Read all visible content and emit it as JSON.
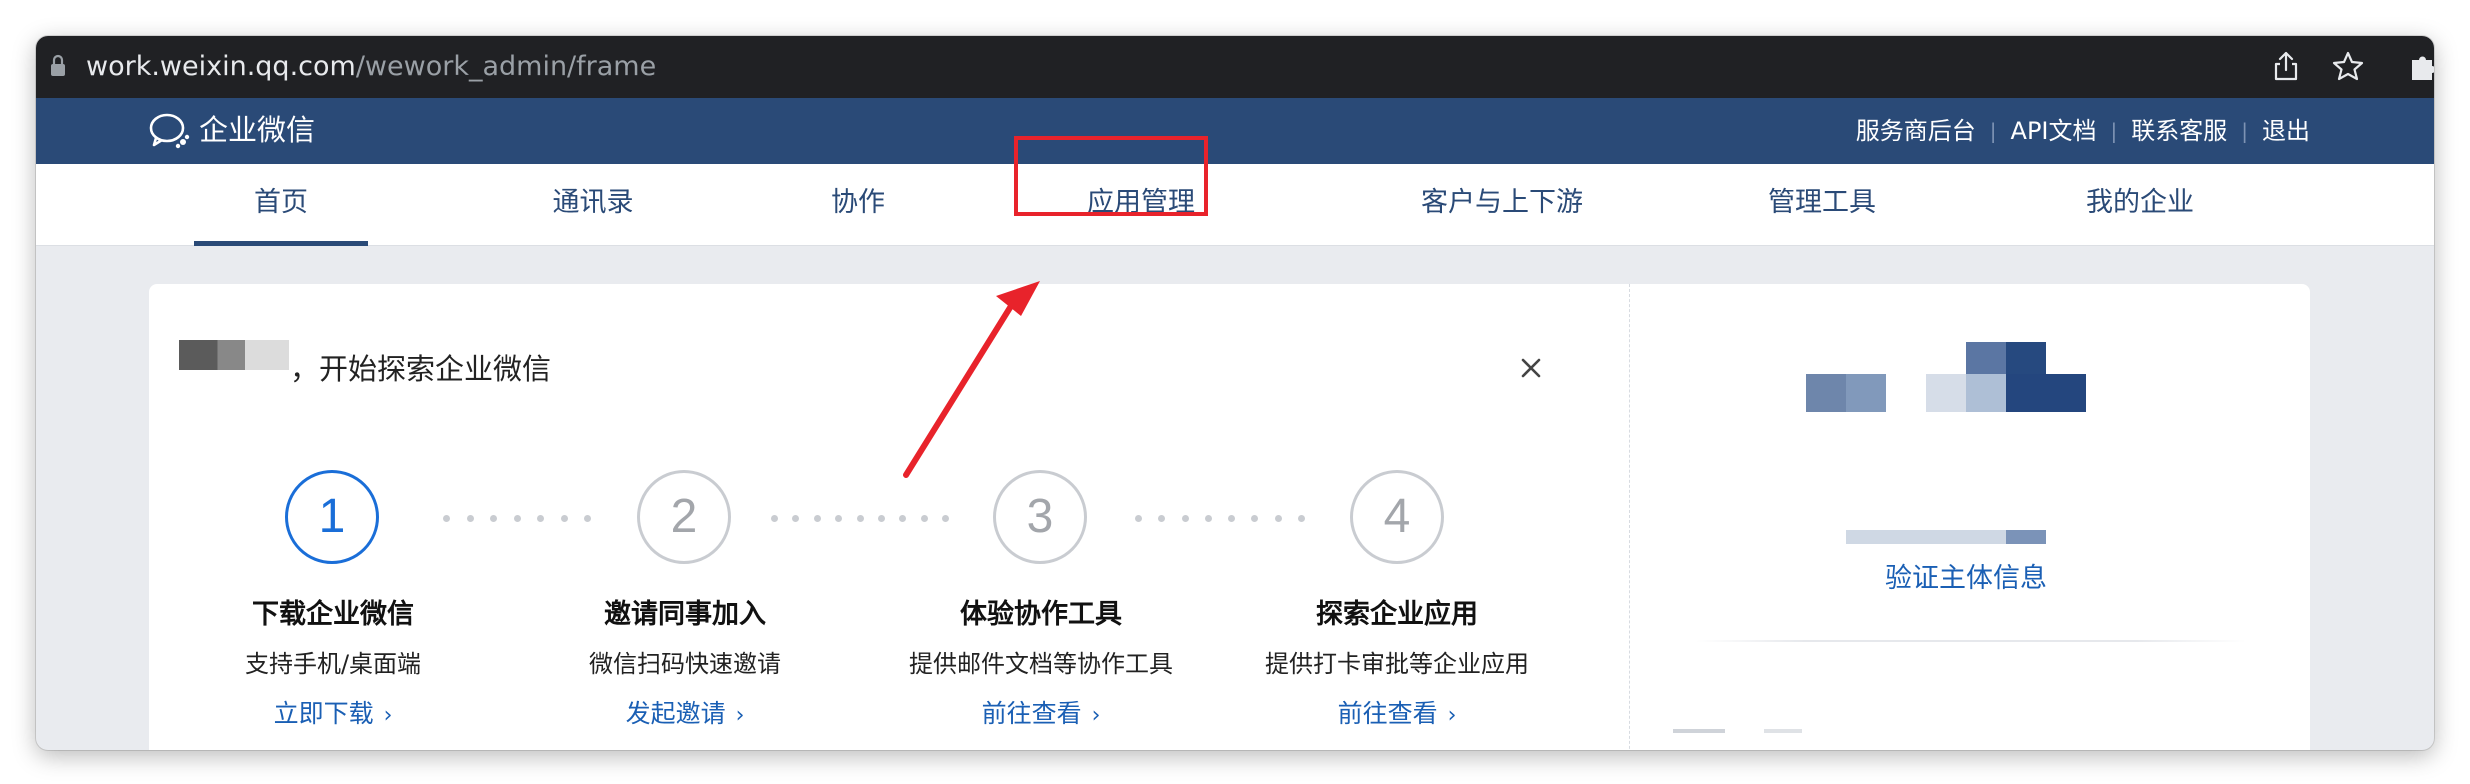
{
  "browser": {
    "url_host": "work.weixin.qq.com",
    "url_path": "/wework_admin/frame",
    "icons": [
      "lock-icon",
      "share-icon",
      "star-icon",
      "extensions-icon"
    ]
  },
  "header": {
    "logo_text": "企业微信",
    "links": [
      "服务商后台",
      "API文档",
      "联系客服",
      "退出"
    ],
    "separator": "|"
  },
  "nav": {
    "tabs": [
      {
        "label": "首页",
        "active": true
      },
      {
        "label": "通讯录",
        "active": false
      },
      {
        "label": "协作",
        "active": false
      },
      {
        "label": "应用管理",
        "active": false,
        "highlighted": true
      },
      {
        "label": "客户与上下游",
        "active": false
      },
      {
        "label": "管理工具",
        "active": false
      },
      {
        "label": "我的企业",
        "active": false
      }
    ]
  },
  "welcome": {
    "text": "，开始探索企业微信",
    "close": "×"
  },
  "steps": [
    {
      "number": "1",
      "title": "下载企业微信",
      "desc": "支持手机/桌面端",
      "link": "立即下载",
      "active": true
    },
    {
      "number": "2",
      "title": "邀请同事加入",
      "desc": "微信扫码快速邀请",
      "link": "发起邀请",
      "active": false
    },
    {
      "number": "3",
      "title": "体验协作工具",
      "desc": "提供邮件文档等协作工具",
      "link": "前往查看",
      "active": false
    },
    {
      "number": "4",
      "title": "探索企业应用",
      "desc": "提供打卡审批等企业应用",
      "link": "前往查看",
      "active": false
    }
  ],
  "right_panel": {
    "verify_link": "验证主体信息"
  },
  "colors": {
    "header_blue": "#2a4a77",
    "link_blue": "#1a5fb4",
    "active_step_blue": "#1a6ed8",
    "annotation_red": "#e8232b"
  }
}
